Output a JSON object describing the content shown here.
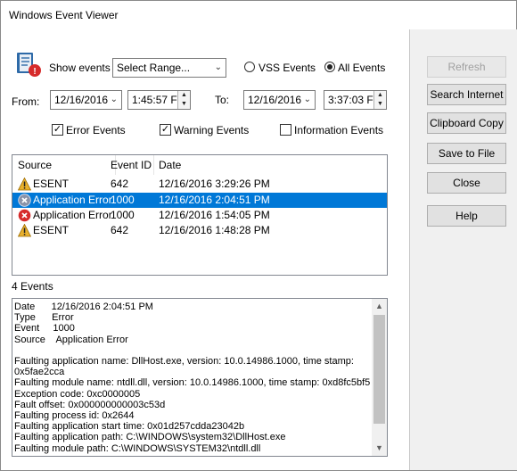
{
  "window": {
    "title": "Windows Event Viewer"
  },
  "filter": {
    "show_events_label": "Show events",
    "range_select": "Select Range...",
    "vss_events_label": "VSS Events",
    "all_events_label": "All Events",
    "selected_mode": "all",
    "from_label": "From:",
    "from_date": "12/16/2016",
    "from_time": "1:45:57 F",
    "to_label": "To:",
    "to_date": "12/16/2016",
    "to_time": "3:37:03 F",
    "error_events_label": "Error Events",
    "warning_events_label": "Warning Events",
    "information_events_label": "Information Events",
    "error_checked": true,
    "warning_checked": true,
    "information_checked": false
  },
  "events_table": {
    "columns": [
      "Source",
      "Event ID",
      "Date"
    ],
    "rows": [
      {
        "source": "ESENT",
        "event_id": "642",
        "date": "12/16/2016 3:29:26 PM",
        "icon": "warning-icon",
        "selected": false
      },
      {
        "source": "Application Error",
        "event_id": "1000",
        "date": "12/16/2016 2:04:51 PM",
        "icon": "error-icon",
        "selected": true
      },
      {
        "source": "Application Error",
        "event_id": "1000",
        "date": "12/16/2016 1:54:05 PM",
        "icon": "error-icon",
        "selected": false
      },
      {
        "source": "ESENT",
        "event_id": "642",
        "date": "12/16/2016 1:48:28 PM",
        "icon": "warning-icon",
        "selected": false
      }
    ]
  },
  "event_count": "4 Events",
  "detail": {
    "text": "Date      12/16/2016 2:04:51 PM\nType      Error\nEvent     1000\nSource    Application Error\n\nFaulting application name: DllHost.exe, version: 10.0.14986.1000, time stamp:\n0x5fae2cca\nFaulting module name: ntdll.dll, version: 10.0.14986.1000, time stamp: 0xd8fc5bf5\nException code: 0xc0000005\nFault offset: 0x000000000003c53d\nFaulting process id: 0x2644\nFaulting application start time: 0x01d257cdda23042b\nFaulting application path: C:\\WINDOWS\\system32\\DllHost.exe\nFaulting module path: C:\\WINDOWS\\SYSTEM32\\ntdll.dll"
  },
  "actions": {
    "refresh": "Refresh",
    "search_internet": "Search Internet",
    "clipboard_copy": "Clipboard Copy",
    "save_to_file": "Save to File",
    "close": "Close",
    "help": "Help"
  },
  "colors": {
    "selection": "#0078d7",
    "panel": "#f0f0f0"
  }
}
